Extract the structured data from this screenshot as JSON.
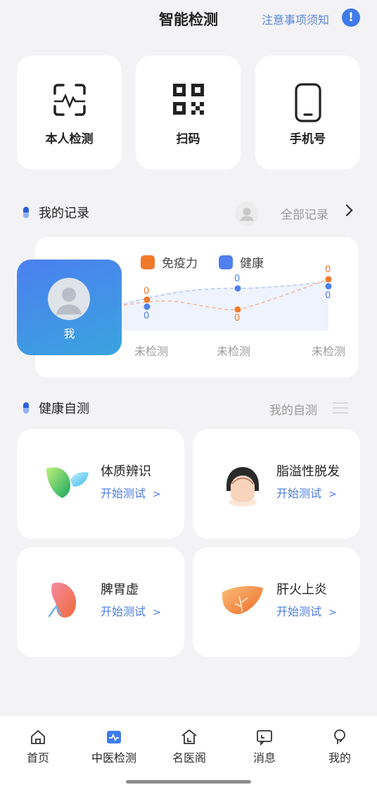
{
  "header": {
    "title": "智能检测",
    "notice_link": "注意事项须知",
    "info_icon": "exclamation-icon"
  },
  "quick_actions": [
    {
      "label": "本人检测",
      "icon": "heartbeat-scan-icon"
    },
    {
      "label": "扫码",
      "icon": "qr-code-icon"
    },
    {
      "label": "手机号",
      "icon": "mobile-phone-icon"
    }
  ],
  "records": {
    "title": "我的记录",
    "all_link": "全部记录",
    "person": "我",
    "legend": [
      {
        "label": "免疫力",
        "color": "#f07a2a"
      },
      {
        "label": "健康",
        "color": "#4f7ff0"
      }
    ],
    "points": [
      {
        "label": "未检测",
        "immunity": "0",
        "health": "0"
      },
      {
        "label": "未检测",
        "immunity": "0",
        "health": "0"
      },
      {
        "label": "未检测",
        "immunity": "0",
        "health": "0"
      }
    ]
  },
  "self_test": {
    "title": "健康自测",
    "my_link": "我的自测",
    "items": [
      {
        "title": "体质辨识",
        "action": "开始测试",
        "arrow": ">"
      },
      {
        "title": "脂溢性脱发",
        "action": "开始测试",
        "arrow": ">"
      },
      {
        "title": "脾胃虚",
        "action": "开始测试",
        "arrow": ">"
      },
      {
        "title": "肝火上炎",
        "action": "开始测试",
        "arrow": ">"
      }
    ]
  },
  "tabbar": {
    "active_index": 1,
    "accent": "#3f7bea",
    "items": [
      {
        "label": "首页",
        "icon": "home-icon"
      },
      {
        "label": "中医检测",
        "icon": "tcm-detect-icon"
      },
      {
        "label": "名医阁",
        "icon": "doctor-hall-icon"
      },
      {
        "label": "消息",
        "icon": "message-icon"
      },
      {
        "label": "我的",
        "icon": "profile-icon"
      }
    ]
  }
}
